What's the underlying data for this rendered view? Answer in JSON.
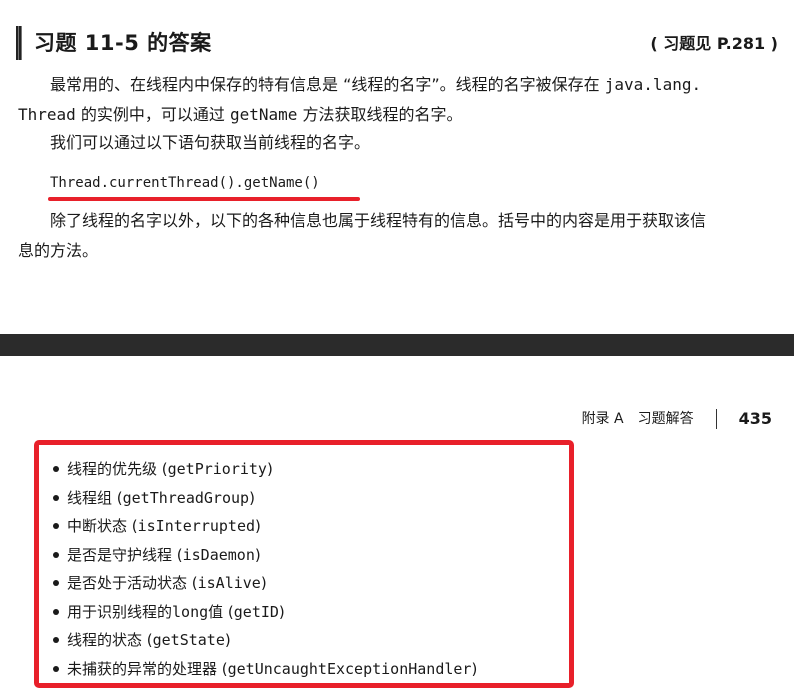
{
  "heading": {
    "title": "习题 11-5 的答案",
    "ref": "( 习题见 P.281 )"
  },
  "para1": {
    "line1_a": "最常用的、在线程内中保存的特有信息是 “线程的名字”。线程的名字被保存在 ",
    "line1_code": "java.lang.",
    "line2_code": "Thread",
    "line2_a": " 的实例中，可以通过 ",
    "line2_code2": "getName",
    "line2_b": " 方法获取线程的名字。"
  },
  "para2": "我们可以通过以下语句获取当前线程的名字。",
  "code": "Thread.currentThread().getName()",
  "para3": {
    "line1": "除了线程的名字以外，以下的各种信息也属于线程特有的信息。括号中的内容是用于获取该信",
    "line2": "息的方法。"
  },
  "running_head": {
    "label": "附录 A　习题解答",
    "page": "435"
  },
  "items": [
    {
      "text": "线程的优先级 ( ",
      "code": "getPriority",
      "suffix": " )"
    },
    {
      "text": "线程组 ( ",
      "code": "getThreadGroup",
      "suffix": " )"
    },
    {
      "text": "中断状态 ( ",
      "code": "isInterrupted",
      "suffix": " )"
    },
    {
      "text": "是否是守护线程 ( ",
      "code": "isDaemon",
      "suffix": " )"
    },
    {
      "text": "是否处于活动状态 ( ",
      "code": "isAlive",
      "suffix": " )"
    },
    {
      "text": "用于识别线程的 ",
      "code": "long",
      "mid": " 值 ( ",
      "code2": "getID",
      "suffix": " )"
    },
    {
      "text": "线程的状态 ( ",
      "code": "getState",
      "suffix": " )"
    },
    {
      "text": "未捕获的异常的处理器 ( ",
      "code": "getUncaughtExceptionHandler",
      "suffix": " )"
    }
  ],
  "colors": {
    "highlight": "#e8202a",
    "divider": "#2b2b2b"
  }
}
